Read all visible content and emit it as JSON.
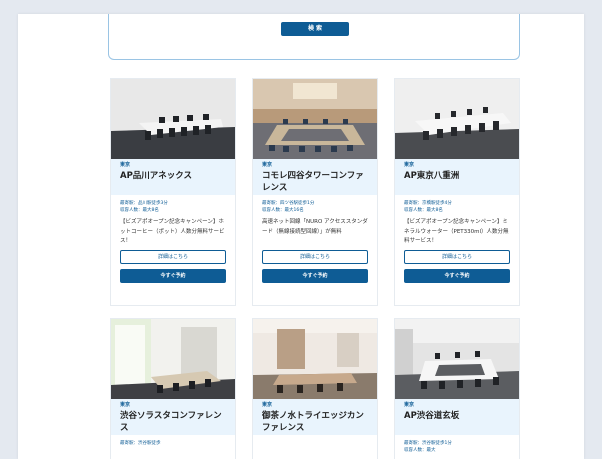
{
  "search": {
    "button_label": "検 索"
  },
  "cards": [
    {
      "area": "東京",
      "name": "AP品川アネックス",
      "access": "最寄駅：品川駅徒歩3分",
      "capacity": "収容人数：最大8名",
      "description": "【ビズアポオープン記念キャンペーン】ホットコーヒー（ポット）人数分無料サービス！",
      "detail_label": "詳細はこちら",
      "reserve_label": "今すぐ予約"
    },
    {
      "area": "東京",
      "name": "コモレ四谷タワーコンファレンス",
      "access": "最寄駅：四ツ谷駅徒歩1分",
      "capacity": "収容人数：最大16名",
      "description": "高速ネット回線「NURO アクセススタンダード（無線接続型回線）」が無料",
      "detail_label": "詳細はこちら",
      "reserve_label": "今すぐ予約"
    },
    {
      "area": "東京",
      "name": "AP東京八重洲",
      "access": "最寄駅：京橋駅徒歩4分",
      "capacity": "収容人数：最大8名",
      "description": "【ビズアポオープン記念キャンペーン】ミネラルウォーター（PET330ml）人数分無料サービス！",
      "detail_label": "詳細はこちら",
      "reserve_label": "今すぐ予約"
    },
    {
      "area": "東京",
      "name": "渋谷ソラスタコンファレンス",
      "access": "最寄駅：渋谷駅徒歩",
      "capacity": "",
      "description": "",
      "detail_label": "",
      "reserve_label": ""
    },
    {
      "area": "東京",
      "name": "御茶ノ水トライエッジカンファレンス",
      "access": "",
      "capacity": "",
      "description": "",
      "detail_label": "",
      "reserve_label": ""
    },
    {
      "area": "東京",
      "name": "AP渋谷道玄坂",
      "access": "最寄駅：渋谷駅徒歩1分",
      "capacity": "収容人数：最大",
      "description": "",
      "detail_label": "",
      "reserve_label": ""
    }
  ],
  "colors": {
    "brand": "#0e5c95",
    "card_head_bg": "#e9f4fd",
    "border": "#9ac4e4"
  }
}
